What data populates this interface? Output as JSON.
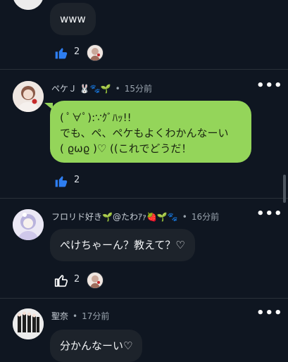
{
  "comments": [
    {
      "text_lines": [
        "www"
      ],
      "likes": "2"
    },
    {
      "author": "ペケＪ 🐰🐾🌱",
      "time": "15分前",
      "text_lines": [
        "( ﾟ∀ﾟ):∵ｸﾞﾊｯ!!",
        "でも、ペ、ペケもよくわかんなーい",
        "( ϱωϱ )♡ ((これでどうだ！"
      ],
      "likes": "2"
    },
    {
      "author": "フロリド好き🌱@たわｱｧ🍓🌱🐾",
      "time": "16分前",
      "text_lines": [
        "ぺけちゃーん？教えて？♡"
      ],
      "likes": "2"
    },
    {
      "author": "聖奈",
      "time": "17分前",
      "text_lines": [
        "分かんなーい♡"
      ]
    }
  ],
  "more_icon": "more-horizontal-icon",
  "like_icon": "thumbs-up-icon",
  "colors": {
    "background": "#0f1621",
    "bubble": "#1d232b",
    "highlight_bubble": "#94d55a",
    "like_active": "#2e7ef1"
  }
}
